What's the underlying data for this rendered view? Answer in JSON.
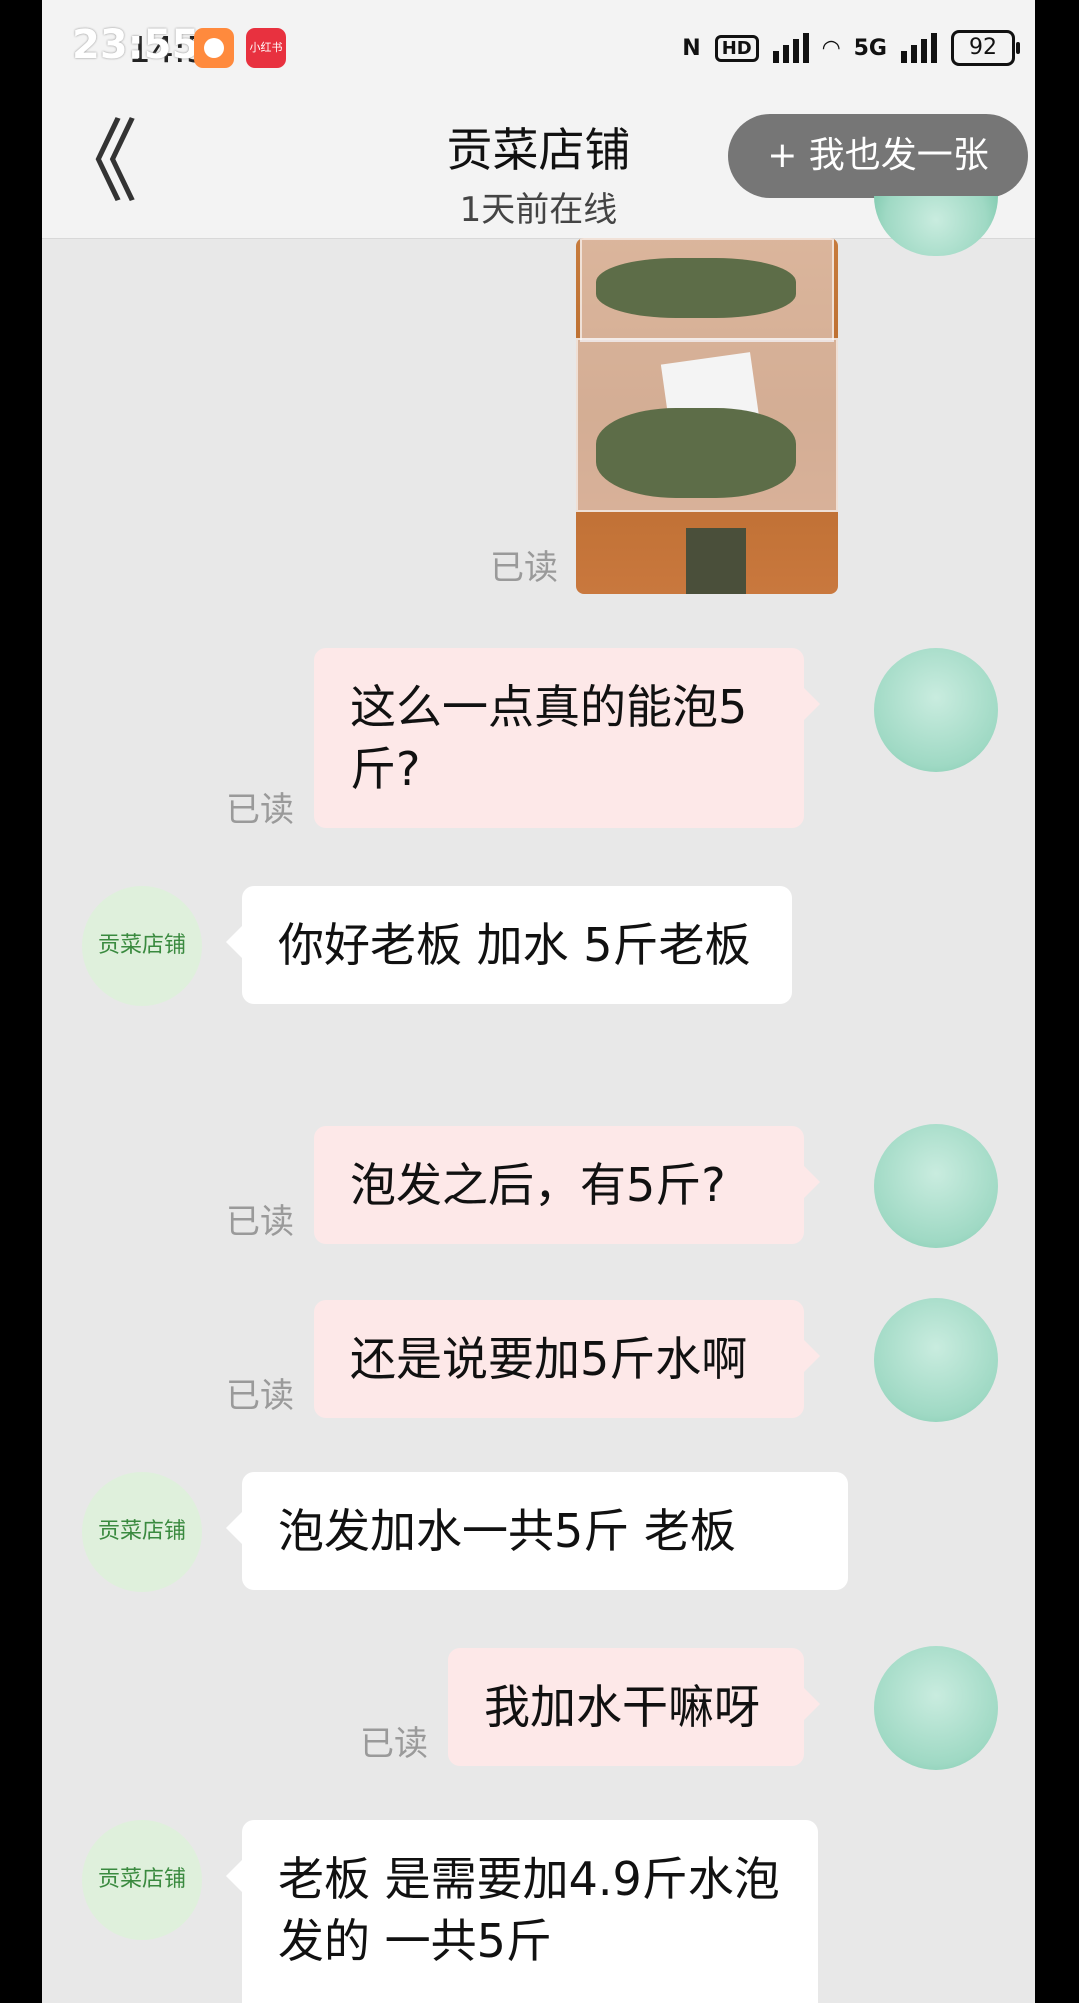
{
  "status_bar": {
    "time": "23:55",
    "time_behind": "14:5",
    "app_badge_text": "小红书",
    "nfc": "N",
    "hd": "HD",
    "network": "5G",
    "battery": "92"
  },
  "header": {
    "back_label": "《",
    "title": "贡菜店铺",
    "subtitle": "1天前在线",
    "post_button": "+ 我也发一张"
  },
  "shop_avatar_text": "贡菜店铺",
  "read_label": "已读",
  "messages": [
    {
      "from": "me",
      "text": "这么一点真的能泡5斤?",
      "read": "已读"
    },
    {
      "from": "shop",
      "text": "你好老板 加水 5斤老板"
    },
    {
      "from": "me",
      "text": "泡发之后，有5斤?",
      "read": "已读"
    },
    {
      "from": "me",
      "text": "还是说要加5斤水啊",
      "read": "已读"
    },
    {
      "from": "shop",
      "text": "泡发加水一共5斤 老板"
    },
    {
      "from": "me",
      "text": "我加水干嘛呀",
      "read": "已读"
    },
    {
      "from": "shop",
      "text": "老板 是需要加4.9斤水泡发的 一共5斤"
    }
  ],
  "colors": {
    "my_bubble": "#fde8e8",
    "shop_bubble": "#ffffff",
    "chat_background": "#e8e8e8"
  }
}
